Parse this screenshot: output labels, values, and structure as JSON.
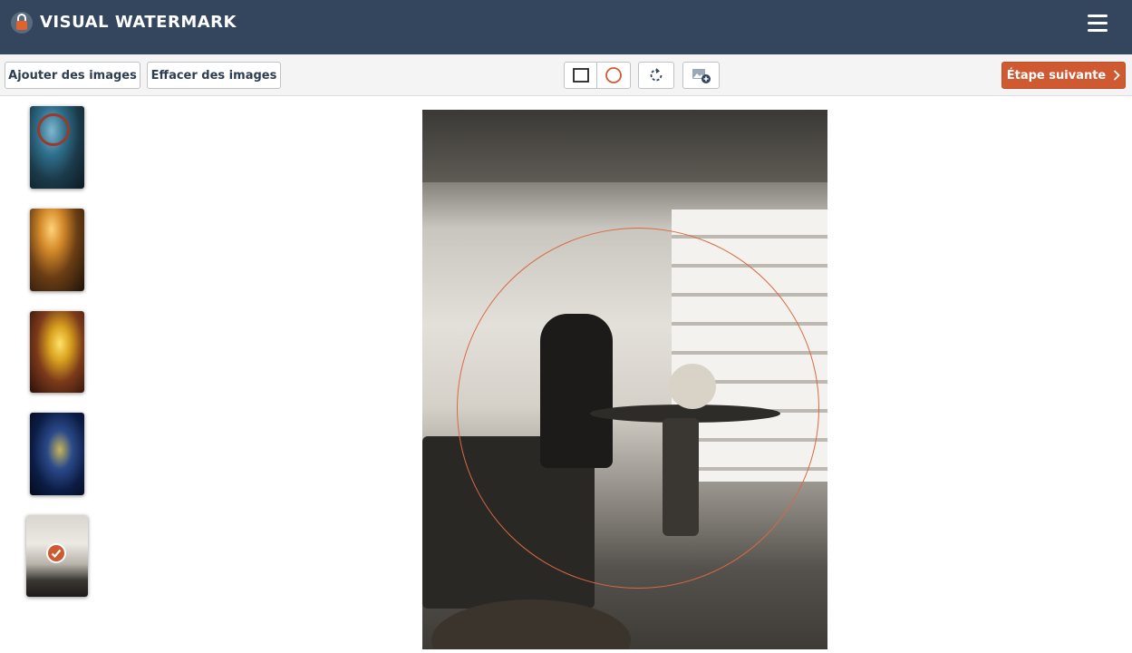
{
  "app": {
    "title": "VISUAL WATERMARK"
  },
  "toolbar": {
    "add_images": "Ajouter des images",
    "clear_images": "Effacer des images",
    "next_step": "Étape suivante"
  },
  "crop_tools": [
    "rectangle-crop",
    "circle-crop",
    "rotate",
    "add-image"
  ],
  "thumbnails": [
    {
      "id": 1,
      "selected": false
    },
    {
      "id": 2,
      "selected": false
    },
    {
      "id": 3,
      "selected": false
    },
    {
      "id": 4,
      "selected": false
    },
    {
      "id": 5,
      "selected": true
    }
  ],
  "colors": {
    "header_bg": "#34465d",
    "accent": "#cf5a32",
    "crop_circle": "#d86a42"
  }
}
